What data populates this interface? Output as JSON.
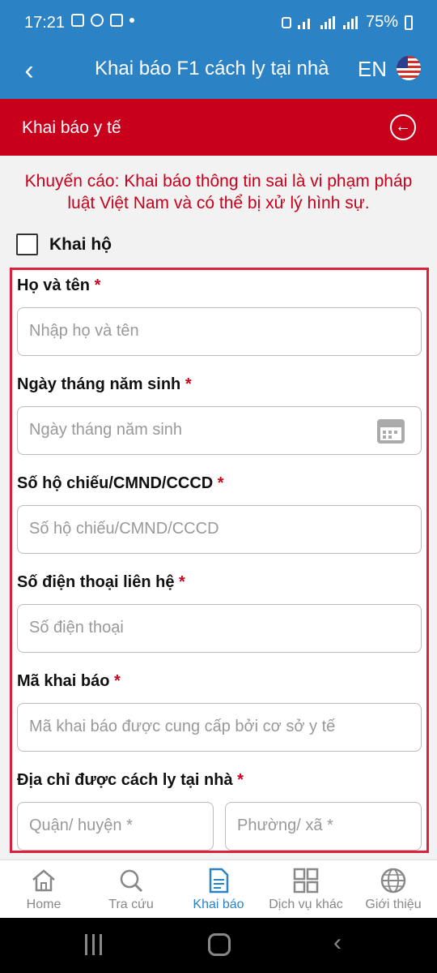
{
  "status_bar": {
    "time": "17:21",
    "battery": "75%"
  },
  "app_bar": {
    "title": "Khai báo F1 cách ly tại nhà",
    "lang": "EN"
  },
  "section_header": {
    "title": "Khai báo y tế"
  },
  "warning": "Khuyến cáo: Khai báo thông tin sai là vi phạm pháp luật Việt Nam và có thể bị xử lý hình sự.",
  "khai_ho": {
    "label": "Khai hộ",
    "checked": false
  },
  "form": {
    "name": {
      "label": "Họ và tên",
      "placeholder": "Nhập họ và tên"
    },
    "dob": {
      "label": "Ngày tháng năm sinh",
      "placeholder": "Ngày tháng năm sinh"
    },
    "id_number": {
      "label": "Số hộ chiếu/CMND/CCCD",
      "placeholder": "Số hộ chiếu/CMND/CCCD"
    },
    "phone": {
      "label": "Số điện thoại liên hệ",
      "placeholder": "Số điện thoại"
    },
    "code": {
      "label": "Mã khai báo",
      "placeholder": "Mã khai báo được cung cấp bởi cơ sở y tế"
    },
    "address": {
      "label": "Địa chỉ được cách ly tại nhà",
      "district_placeholder": "Quận/ huyện *",
      "ward_placeholder": "Phường/ xã *"
    },
    "required_mark": "*"
  },
  "bottom_nav": [
    {
      "label": "Home"
    },
    {
      "label": "Tra cứu"
    },
    {
      "label": "Khai báo"
    },
    {
      "label": "Dịch vụ khác"
    },
    {
      "label": "Giới thiệu"
    }
  ],
  "colors": {
    "primary": "#2b82c4",
    "header_red": "#c8001b",
    "required": "#d0021b",
    "form_border": "#e0203a"
  }
}
